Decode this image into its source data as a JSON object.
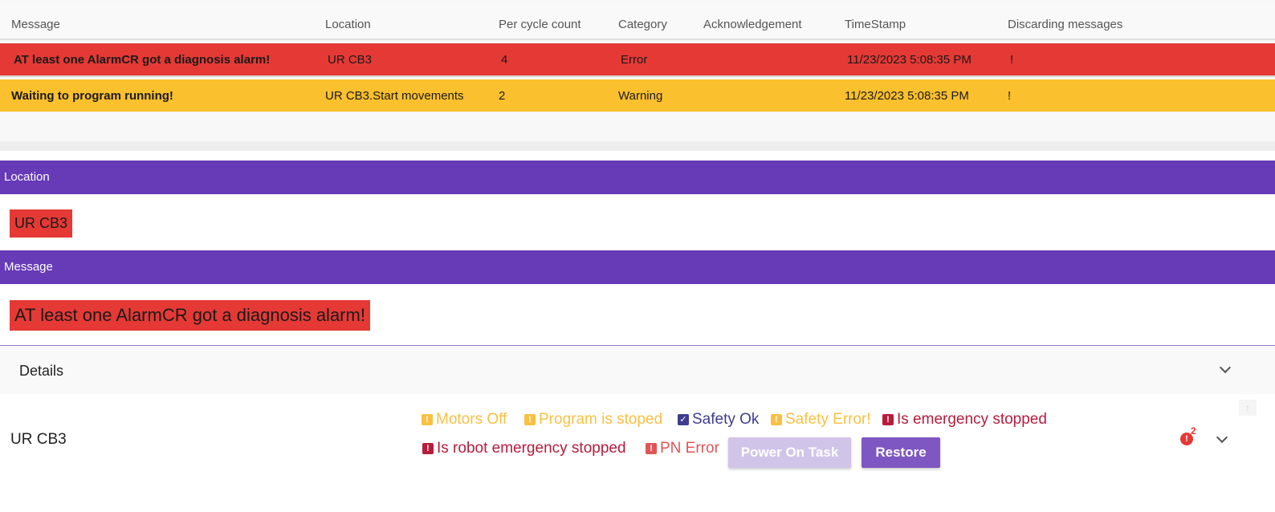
{
  "table": {
    "columns": [
      "Message",
      "Location",
      "Per cycle count",
      "Category",
      "Acknowledgement",
      "TimeStamp",
      "Discarding messages"
    ],
    "rows": [
      {
        "message": "AT least one AlarmCR got a diagnosis alarm!",
        "location": "UR CB3",
        "count": "4",
        "category": "Error",
        "acknowledgement": "",
        "timestamp": "11/23/2023 5:08:35 PM",
        "discard": "!"
      },
      {
        "message": "Waiting to program running!",
        "location": "UR CB3.Start movements",
        "count": "2",
        "category": "Warning",
        "acknowledgement": "",
        "timestamp": "11/23/2023 5:08:35 PM",
        "discard": "!"
      }
    ]
  },
  "detail": {
    "location_header": "Location",
    "location_value": "UR CB3",
    "message_header": "Message",
    "message_value": "AT least one AlarmCR got a diagnosis alarm!",
    "details_label": "Details"
  },
  "robot": {
    "name": "UR CB3",
    "statuses": {
      "motors_off": "Motors Off",
      "program_stopped": "Program is stoped",
      "safety_ok": "Safety Ok",
      "safety_error": "Safety Error!",
      "emergency_stopped": "Is emergency stopped",
      "robot_emergency_stopped": "Is robot emergency stopped",
      "pn_error": "PN Error"
    },
    "badges": {
      "warn": "!",
      "check": "✓",
      "error": "!"
    },
    "power_on_label": "Power On Task",
    "restore_label": "Restore",
    "alert_count": "2",
    "alert_glyph": "!"
  },
  "icons": {
    "details_chevron": "chevron-down-icon",
    "row_chevron": "chevron-down-icon",
    "scroll_top": "arrow-up-icon",
    "scroll_glyph": "↑"
  },
  "colors": {
    "error": "#e53935",
    "warning": "#fbc02d",
    "accent": "#673ab7",
    "button_primary": "#7e57c2",
    "button_disabled": "#d1c4e9"
  }
}
